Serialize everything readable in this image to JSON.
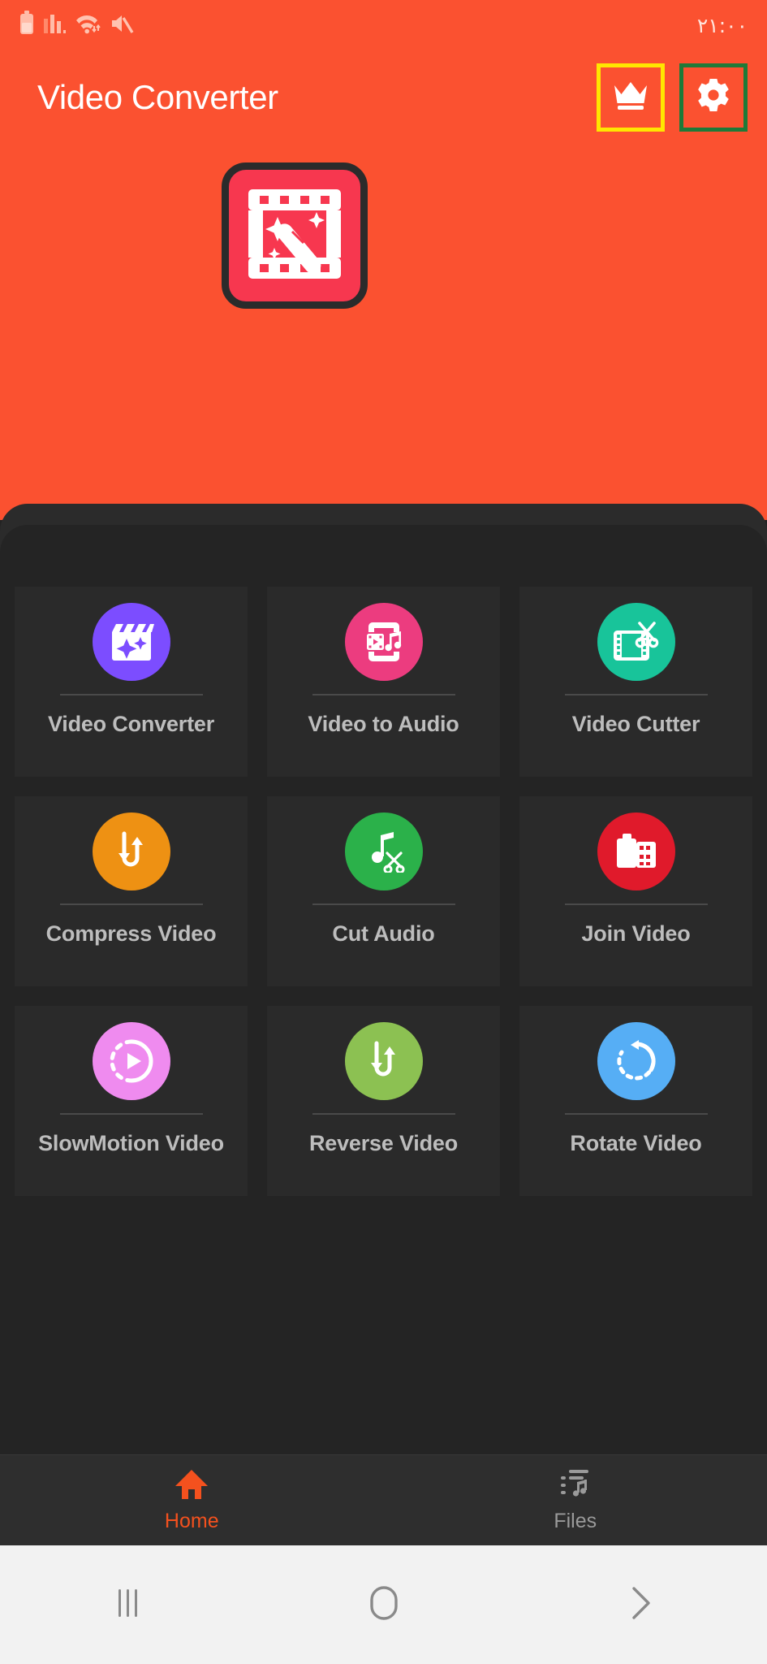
{
  "status_bar": {
    "clock": "۲۱:۰۰",
    "icons": [
      "battery-icon",
      "signal-bars-icon",
      "wifi-icon",
      "mute-icon"
    ]
  },
  "app_bar": {
    "title": "Video Converter",
    "premium_icon": "crown-icon",
    "settings_icon": "gear-icon",
    "premium_highlight_color": "#FFE600",
    "settings_highlight_color": "#1E7A38"
  },
  "hero": {
    "logo_icon": "video-editor-app-logo",
    "logo_bg": "#F7374F",
    "header_bg": "#FB5130"
  },
  "grid": {
    "items": [
      {
        "label": "Video Converter",
        "icon": "clapperboard-sparkle-icon",
        "color": "#7C4DFF"
      },
      {
        "label": "Video to Audio",
        "icon": "phone-film-music-icon",
        "color": "#EC3C7F"
      },
      {
        "label": "Video Cutter",
        "icon": "film-scissors-icon",
        "color": "#18C49A"
      },
      {
        "label": "Compress Video",
        "icon": "compress-arrows-icon",
        "color": "#EE9113"
      },
      {
        "label": "Cut Audio",
        "icon": "music-scissors-icon",
        "color": "#2BB14A"
      },
      {
        "label": "Join Video",
        "icon": "join-film-icon",
        "color": "#E01A2B"
      },
      {
        "label": "SlowMotion Video",
        "icon": "slow-motion-play-icon",
        "color": "#EF8BEF"
      },
      {
        "label": "Reverse Video",
        "icon": "reverse-arrows-icon",
        "color": "#8CC152"
      },
      {
        "label": "Rotate Video",
        "icon": "rotate-arrow-icon",
        "color": "#56AEF5"
      }
    ]
  },
  "bottom_tabs": {
    "items": [
      {
        "label": "Home",
        "icon": "home-icon",
        "active": true,
        "color": "#F4511E"
      },
      {
        "label": "Files",
        "icon": "files-music-icon",
        "active": false,
        "color": "#9a9a9a"
      }
    ]
  },
  "android_nav": {
    "recent_label": "|||",
    "home_label": "O",
    "back_label": ">",
    "icons": [
      "recents-icon",
      "home-circle-icon",
      "back-chevron-icon"
    ]
  }
}
